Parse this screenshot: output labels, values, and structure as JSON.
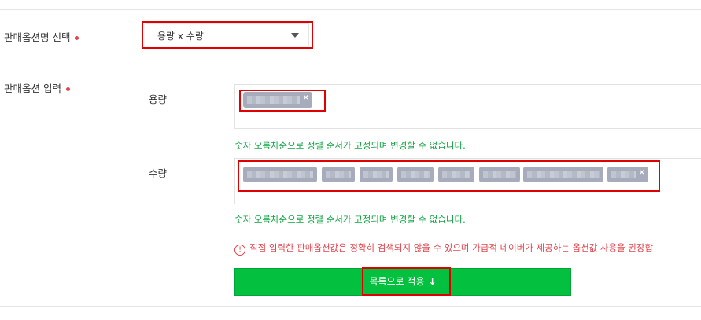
{
  "section_option_type": {
    "label": "판매옵션명 선택",
    "select_value": "용량 x 수량"
  },
  "section_option_input": {
    "label": "판매옵션 입력",
    "fields": [
      {
        "label": "용량",
        "help": "숫자 오름차순으로 정렬 순서가 고정되며 변경할 수 없습니다."
      },
      {
        "label": "수량",
        "help": "숫자 오름차순으로 정렬 순서가 고정되며 변경할 수 없습니다."
      }
    ],
    "warning": "직접 입력한 판매옵션값은 정확히 검색되지 않을 수 있으며 가급적 네이버가 제공하는 옵션값 사용을 권장합",
    "warning_icon": "!",
    "apply_button": "목록으로 적용",
    "apply_arrow": "↓",
    "tag_remove_glyph": "×"
  },
  "colors": {
    "required_dot": "#e0454d",
    "help_text": "#12a543",
    "warning_text": "#e0454d",
    "button_bg": "#03c13e",
    "tag_bg": "#a6acbb",
    "highlight_box": "#e00000"
  }
}
